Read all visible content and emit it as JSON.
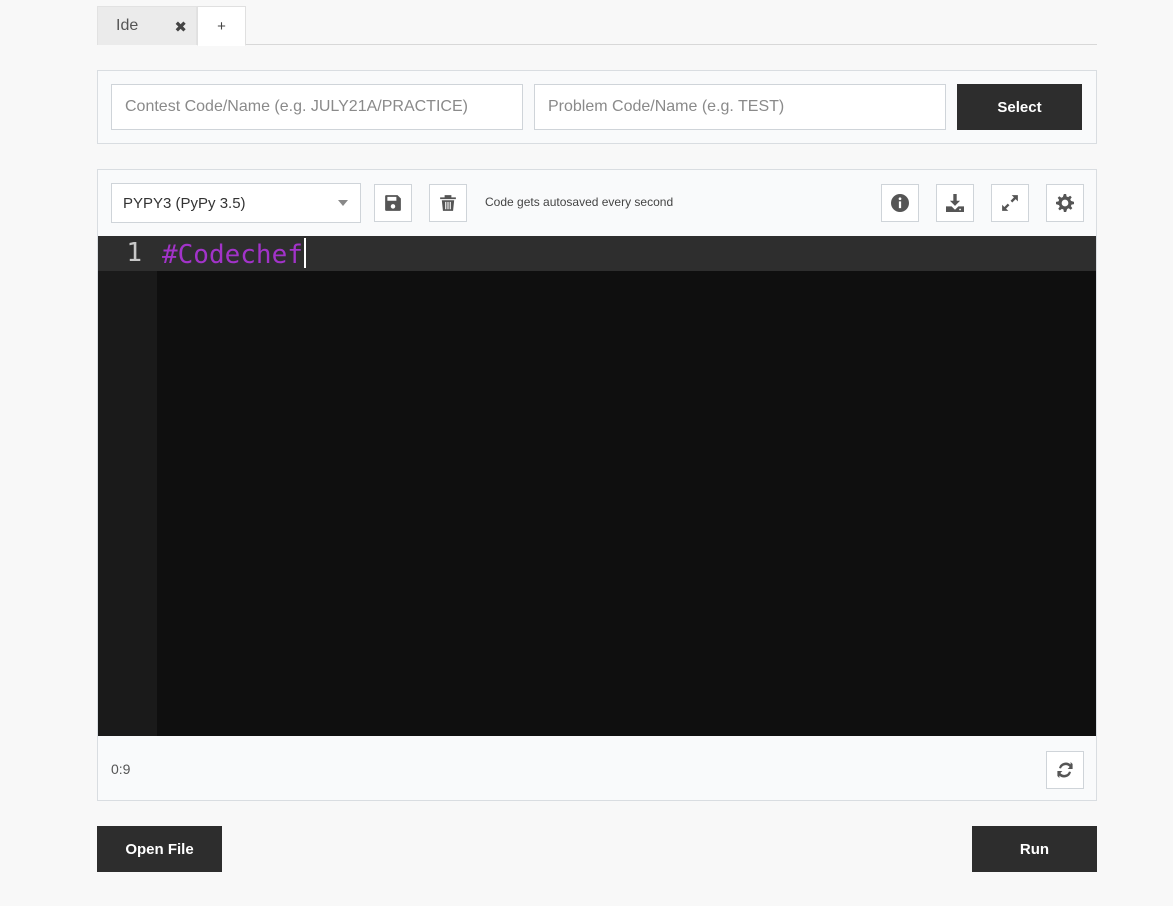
{
  "tabs": {
    "items": [
      {
        "label": "Ide",
        "close": "✖"
      }
    ],
    "add_label": "+"
  },
  "problem_select": {
    "contest_placeholder": "Contest Code/Name (e.g. JULY21A/PRACTICE)",
    "problem_placeholder": "Problem Code/Name (e.g. TEST)",
    "select_label": "Select"
  },
  "editor": {
    "language": "PYPY3 (PyPy 3.5)",
    "autosave_text": "Code gets autosaved every second",
    "lines": [
      {
        "number": "1",
        "text": "#Codechef"
      }
    ],
    "cursor_position": "0:9",
    "colors": {
      "background": "#0f0f0f",
      "comment": "#a233c9",
      "gutter": "#1a1a1a",
      "active_line": "#2e2e2e"
    },
    "toolbar_icons": [
      "save-icon",
      "trash-icon",
      "info-icon",
      "download-icon",
      "expand-icon",
      "gear-icon"
    ],
    "status_icons": [
      "refresh-icon"
    ]
  },
  "actions": {
    "open_file_label": "Open File",
    "run_label": "Run"
  }
}
